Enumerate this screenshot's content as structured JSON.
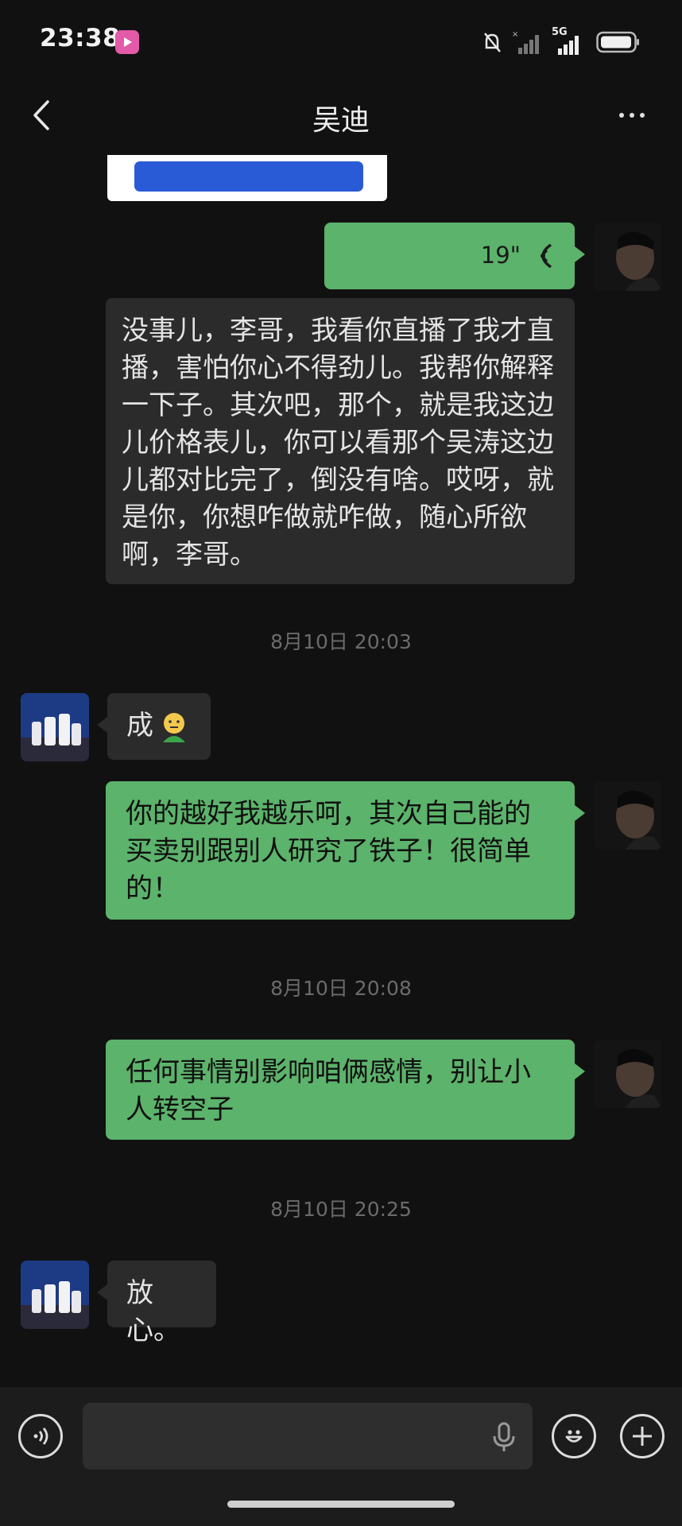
{
  "status_bar": {
    "time": "23:38",
    "network": "5G"
  },
  "header": {
    "title": "吴迪"
  },
  "card": {
    "button_label": ""
  },
  "messages": [
    {
      "voice_duration": "19\""
    },
    {
      "text": "没事儿，李哥，我看你直播了我才直播，害怕你心不得劲儿。我帮你解释一下子。其次吧，那个，就是我这边儿价格表儿，你可以看那个吴涛这边儿都对比完了，倒没有啥。哎呀，就是你，你想咋做就咋做，随心所欲啊，李哥。"
    },
    {
      "text": "成"
    },
    {
      "text": "你的越好我越乐呵，其次自己能的买卖别跟别人研究了铁子！很简单的！"
    },
    {
      "text": "任何事情别影响咱俩感情，别让小人转空子"
    },
    {
      "text": "放心。"
    }
  ],
  "timestamps": [
    "8月10日 20:03",
    "8月10日 20:08",
    "8月10日 20:25"
  ],
  "icons": [
    "back-icon",
    "more-icon",
    "voice-wave-icon",
    "voice-mode-icon",
    "mic-icon",
    "emoji-icon",
    "plus-icon"
  ],
  "colors": {
    "background": "#111111",
    "green_bubble": "#5cb36b",
    "dark_bubble": "#2b2b2b"
  }
}
